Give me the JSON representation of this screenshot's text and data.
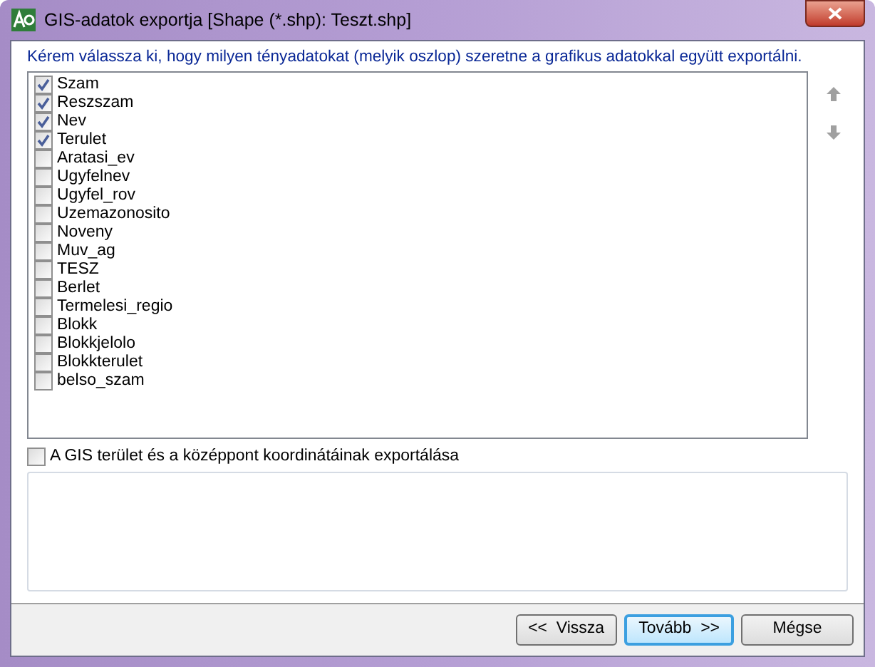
{
  "window": {
    "title": "GIS-adatok exportja [Shape (*.shp): Teszt.shp]"
  },
  "instruction": "Kérem válassza ki, hogy milyen tényadatokat (melyik oszlop) szeretne a grafikus adatokkal együtt exportálni.",
  "fields": [
    {
      "label": "Szam",
      "checked": true
    },
    {
      "label": "Reszszam",
      "checked": true
    },
    {
      "label": "Nev",
      "checked": true
    },
    {
      "label": "Terulet",
      "checked": true
    },
    {
      "label": "Aratasi_ev",
      "checked": false
    },
    {
      "label": "Ugyfelnev",
      "checked": false
    },
    {
      "label": "Ugyfel_rov",
      "checked": false
    },
    {
      "label": "Uzemazonosito",
      "checked": false
    },
    {
      "label": "Noveny",
      "checked": false
    },
    {
      "label": "Muv_ag",
      "checked": false
    },
    {
      "label": "TESZ",
      "checked": false
    },
    {
      "label": "Berlet",
      "checked": false
    },
    {
      "label": "Termelesi_regio",
      "checked": false
    },
    {
      "label": "Blokk",
      "checked": false
    },
    {
      "label": "Blokkjelolo",
      "checked": false
    },
    {
      "label": "Blokkterulet",
      "checked": false
    },
    {
      "label": "belso_szam",
      "checked": false
    }
  ],
  "export_coordinates": {
    "label": "A GIS terület és a középpont koordinátáinak exportálása",
    "checked": false
  },
  "buttons": [
    {
      "label": "<<  Vissza",
      "selected": false
    },
    {
      "label": "Tovább  >>",
      "selected": true
    },
    {
      "label": "Mégse",
      "selected": false
    }
  ]
}
